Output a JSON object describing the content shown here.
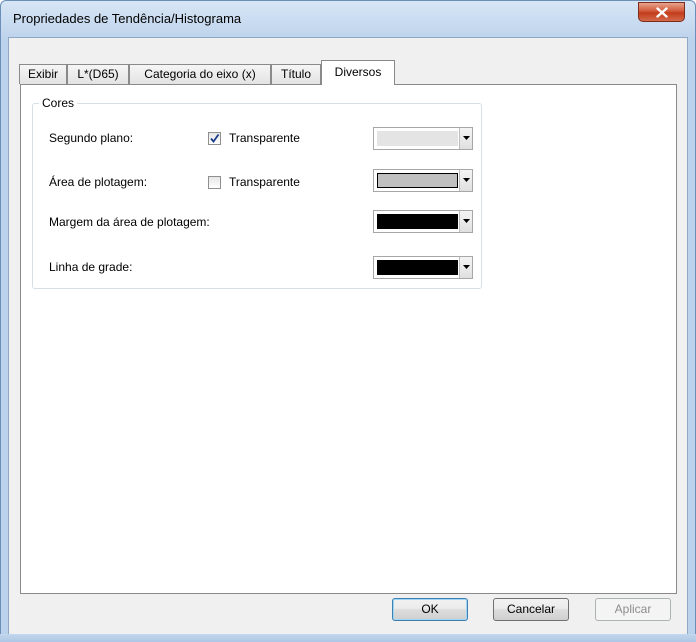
{
  "window": {
    "title": "Propriedades de Tendência/Histograma",
    "close_icon": "close-icon"
  },
  "tabs": [
    {
      "label": "Exibir",
      "active": false
    },
    {
      "label": "L*(D65)",
      "active": false
    },
    {
      "label": "Categoria do eixo  (x)",
      "active": false
    },
    {
      "label": "Título",
      "active": false
    },
    {
      "label": "Diversos",
      "active": true
    }
  ],
  "group": {
    "label": "Cores",
    "rows": [
      {
        "label": "Segundo plano:",
        "has_checkbox": true,
        "checkbox_label": "Transparente",
        "checked": true,
        "color": "#e4e4e4"
      },
      {
        "label": "Área de plotagem:",
        "has_checkbox": true,
        "checkbox_label": "Transparente",
        "checked": false,
        "color": "#c0c0c0"
      },
      {
        "label": "Margem da área de plotagem:",
        "has_checkbox": false,
        "color": "#000000"
      },
      {
        "label": "Linha de grade:",
        "has_checkbox": false,
        "color": "#000000"
      }
    ]
  },
  "buttons": {
    "ok": "OK",
    "cancel": "Cancelar",
    "apply": "Aplicar"
  },
  "colors": {
    "close_red": "#c23c1b",
    "check_blue": "#1a3c8c"
  }
}
